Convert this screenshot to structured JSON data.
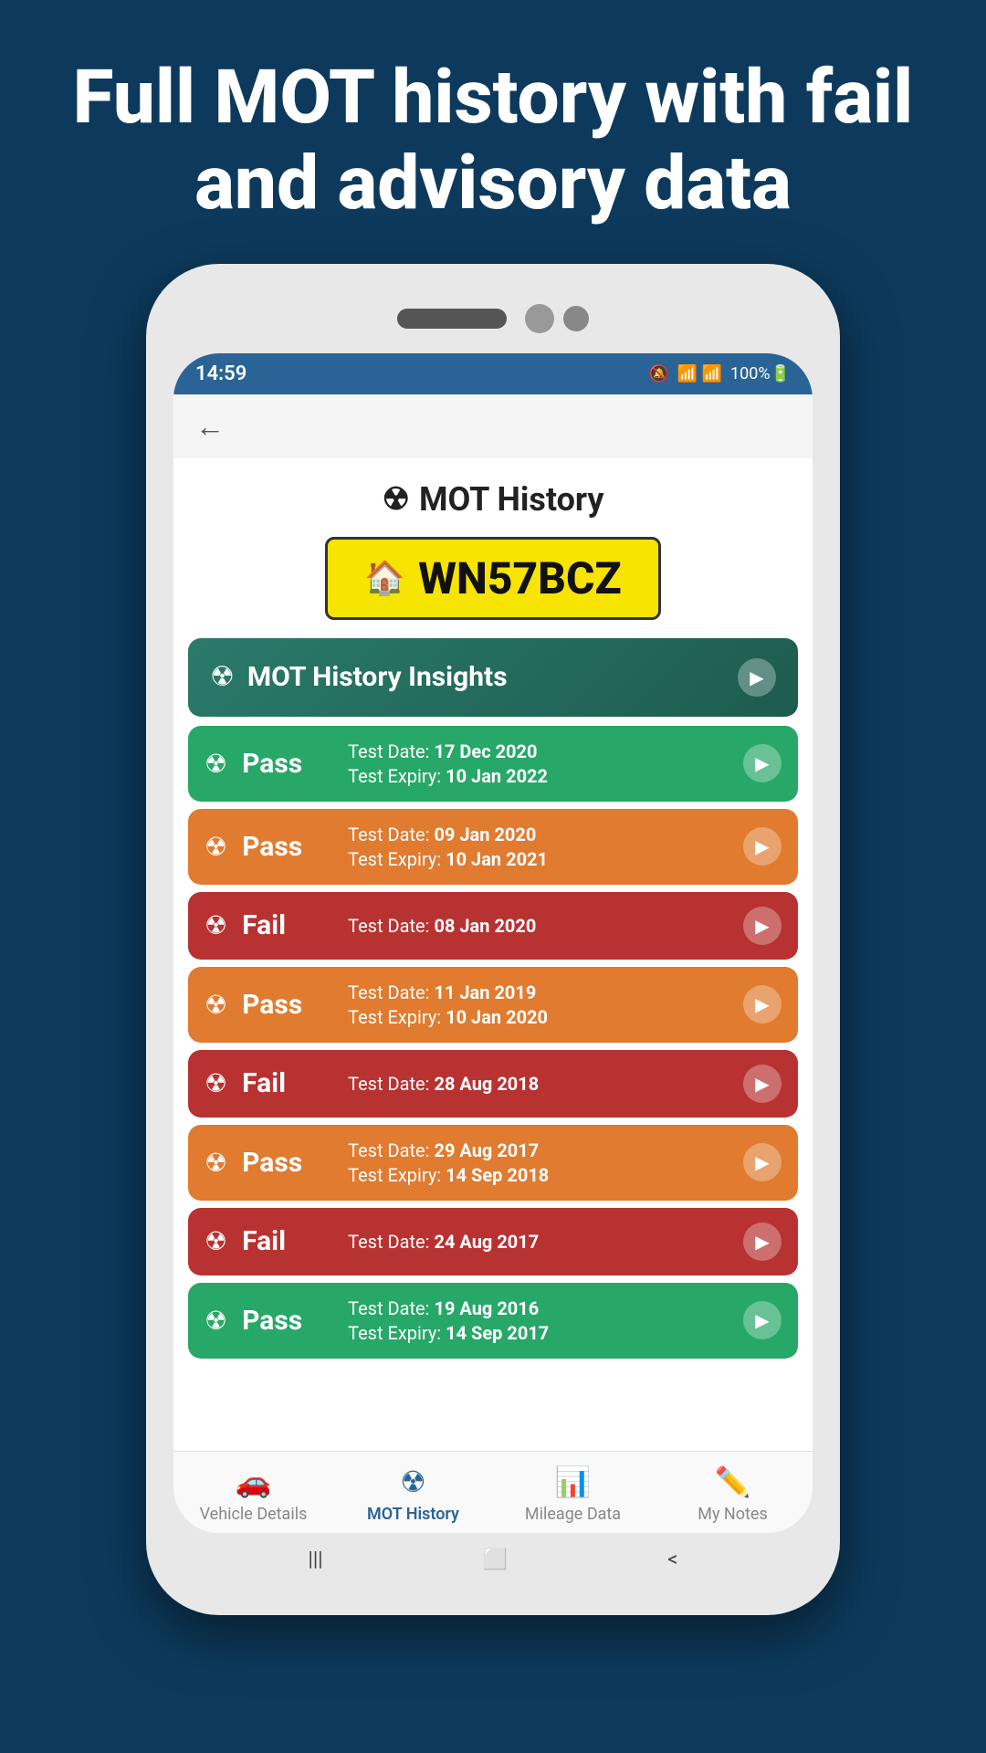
{
  "hero": {
    "text": "Full MOT history with fail and advisory data"
  },
  "statusBar": {
    "time": "14:59",
    "icons": "🔕 📶 📶 100%"
  },
  "appHeader": {
    "backLabel": "←"
  },
  "pageTitle": {
    "icon": "☢",
    "label": "MOT History"
  },
  "licensePlate": {
    "icon": "🏠",
    "number": "WN57BCZ"
  },
  "insightsCard": {
    "icon": "☢",
    "label": "MOT History Insights"
  },
  "motItems": [
    {
      "type": "pass",
      "color": "pass-green",
      "result": "Pass",
      "testDate": "17 Dec 2020",
      "expiryDate": "10 Jan 2022"
    },
    {
      "type": "pass",
      "color": "pass-orange",
      "result": "Pass",
      "testDate": "09 Jan 2020",
      "expiryDate": "10 Jan 2021"
    },
    {
      "type": "fail",
      "color": "fail-red",
      "result": "Fail",
      "testDate": "08 Jan 2020",
      "expiryDate": null
    },
    {
      "type": "pass",
      "color": "pass-orange",
      "result": "Pass",
      "testDate": "11 Jan 2019",
      "expiryDate": "10 Jan 2020"
    },
    {
      "type": "fail",
      "color": "fail-red",
      "result": "Fail",
      "testDate": "28 Aug 2018",
      "expiryDate": null
    },
    {
      "type": "pass",
      "color": "pass-orange",
      "result": "Pass",
      "testDate": "29 Aug 2017",
      "expiryDate": "14 Sep 2018"
    },
    {
      "type": "fail",
      "color": "fail-red",
      "result": "Fail",
      "testDate": "24 Aug 2017",
      "expiryDate": null
    },
    {
      "type": "pass",
      "color": "pass-green",
      "result": "Pass",
      "testDate": "19 Aug 2016",
      "expiryDate": "14 Sep 2017"
    }
  ],
  "bottomNav": {
    "items": [
      {
        "icon": "🚗",
        "label": "Vehicle Details",
        "active": false
      },
      {
        "icon": "☢",
        "label": "MOT History",
        "active": true
      },
      {
        "icon": "📊",
        "label": "Mileage Data",
        "active": false
      },
      {
        "icon": "✏️",
        "label": "My Notes",
        "active": false
      }
    ]
  },
  "systemNav": {
    "back": "<",
    "home": "⬜",
    "recents": "|||"
  },
  "labels": {
    "testDate": "Test Date: ",
    "testExpiry": "Test Expiry: "
  }
}
